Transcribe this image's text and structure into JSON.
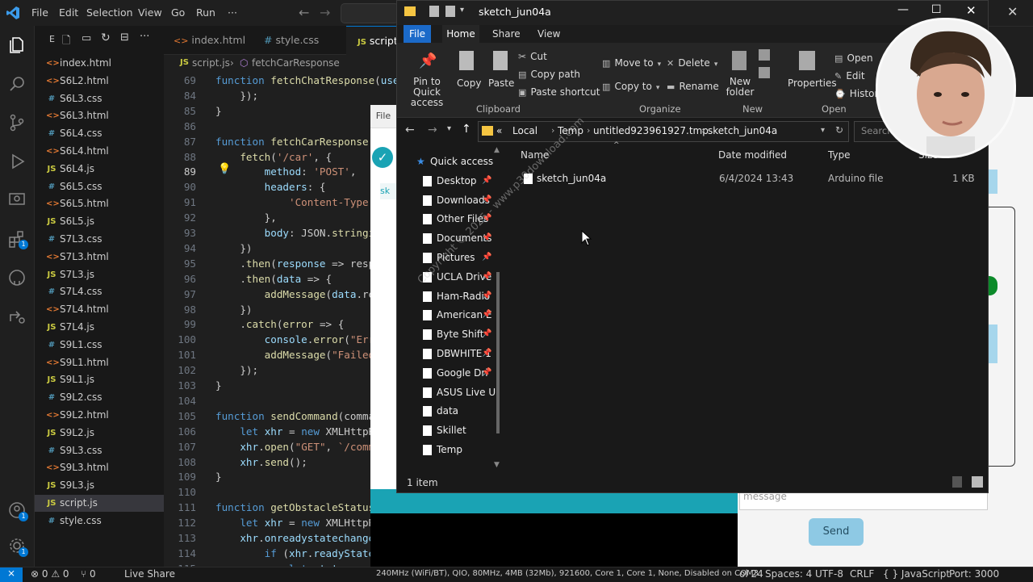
{
  "vscode": {
    "menu": [
      "File",
      "Edit",
      "Selection",
      "View",
      "Go",
      "Run",
      "···"
    ],
    "explorer_header": "E",
    "files": [
      {
        "name": "index.html",
        "type": "html"
      },
      {
        "name": "S6L2.html",
        "type": "html"
      },
      {
        "name": "S6L3.css",
        "type": "css"
      },
      {
        "name": "S6L3.html",
        "type": "html"
      },
      {
        "name": "S6L4.css",
        "type": "css"
      },
      {
        "name": "S6L4.html",
        "type": "html"
      },
      {
        "name": "S6L4.js",
        "type": "js"
      },
      {
        "name": "S6L5.css",
        "type": "css"
      },
      {
        "name": "S6L5.html",
        "type": "html"
      },
      {
        "name": "S6L5.js",
        "type": "js"
      },
      {
        "name": "S7L3.css",
        "type": "css"
      },
      {
        "name": "S7L3.html",
        "type": "html"
      },
      {
        "name": "S7L3.js",
        "type": "js"
      },
      {
        "name": "S7L4.css",
        "type": "css"
      },
      {
        "name": "S7L4.html",
        "type": "html"
      },
      {
        "name": "S7L4.js",
        "type": "js"
      },
      {
        "name": "S9L1.css",
        "type": "css"
      },
      {
        "name": "S9L1.html",
        "type": "html"
      },
      {
        "name": "S9L1.js",
        "type": "js"
      },
      {
        "name": "S9L2.css",
        "type": "css"
      },
      {
        "name": "S9L2.html",
        "type": "html"
      },
      {
        "name": "S9L2.js",
        "type": "js"
      },
      {
        "name": "S9L3.css",
        "type": "css"
      },
      {
        "name": "S9L3.html",
        "type": "html"
      },
      {
        "name": "S9L3.js",
        "type": "js"
      },
      {
        "name": "script.js",
        "type": "js",
        "selected": true
      },
      {
        "name": "style.css",
        "type": "css"
      }
    ],
    "tabs": [
      "index.html",
      "style.css",
      "script"
    ],
    "breadcrumb": {
      "file": "script.js",
      "symbol": "fetchCarResponse"
    },
    "code_lines": [
      {
        "n": "69",
        "t": "function fetchChatResponse(user"
      },
      {
        "n": "84",
        "t": "    });"
      },
      {
        "n": "85",
        "t": "}"
      },
      {
        "n": "86",
        "t": ""
      },
      {
        "n": "87",
        "t": "function fetchCarResponse(u"
      },
      {
        "n": "88",
        "t": "    fetch('/car', {"
      },
      {
        "n": "89",
        "t": "        method: 'POST',"
      },
      {
        "n": "90",
        "t": "        headers: {"
      },
      {
        "n": "91",
        "t": "            'Content-Type'"
      },
      {
        "n": "92",
        "t": "        },"
      },
      {
        "n": "93",
        "t": "        body: JSON.stringi"
      },
      {
        "n": "94",
        "t": "    })"
      },
      {
        "n": "95",
        "t": "    .then(response => respo"
      },
      {
        "n": "96",
        "t": "    .then(data => {"
      },
      {
        "n": "97",
        "t": "        addMessage(data.res"
      },
      {
        "n": "98",
        "t": "    })"
      },
      {
        "n": "99",
        "t": "    .catch(error => {"
      },
      {
        "n": "100",
        "t": "        console.error(\"Erro"
      },
      {
        "n": "101",
        "t": "        addMessage(\"Failed"
      },
      {
        "n": "102",
        "t": "    });"
      },
      {
        "n": "103",
        "t": "}"
      },
      {
        "n": "104",
        "t": ""
      },
      {
        "n": "105",
        "t": "function sendCommand(comma"
      },
      {
        "n": "106",
        "t": "    let xhr = new XMLHttpRe"
      },
      {
        "n": "107",
        "t": "    xhr.open(\"GET\", `/comma"
      },
      {
        "n": "108",
        "t": "    xhr.send();"
      },
      {
        "n": "109",
        "t": "}"
      },
      {
        "n": "110",
        "t": ""
      },
      {
        "n": "111",
        "t": "function getObstacleStatus("
      },
      {
        "n": "112",
        "t": "    let xhr = new XMLHttpRe"
      },
      {
        "n": "113",
        "t": "    xhr.onreadystatechange"
      },
      {
        "n": "114",
        "t": "        if (xhr.readyState"
      },
      {
        "n": "115",
        "t": "            let status = xh"
      }
    ],
    "status": {
      "problems": "⊗ 0 ⚠ 0",
      "ports": "⑂ 0",
      "live_share": "Live Share",
      "arduino_board": "240MHz (WiFi/BT), QIO, 80MHz, 4MB (32Mb), 921600, Core 1, Core 1, None, Disabled on COM3",
      "ln": "ol 24",
      "spaces": "Spaces: 4",
      "encoding": "UTF-8",
      "eol": "CRLF",
      "language": "{ } JavaScript",
      "port": "Port: 3000"
    }
  },
  "explorer_window": {
    "title": "sketch_jun04a",
    "menu": [
      "File",
      "Home",
      "Share",
      "View"
    ],
    "ribbon": {
      "clipboard": {
        "pin": "Pin to Quick access",
        "copy": "Copy",
        "paste": "Paste",
        "cut": "Cut",
        "copy_path": "Copy path",
        "paste_shortcut": "Paste shortcut",
        "group": "Clipboard"
      },
      "organize": {
        "move_to": "Move to",
        "copy_to": "Copy to",
        "delete": "Delete",
        "rename": "Rename",
        "group": "Organize"
      },
      "new": {
        "new_folder": "New folder",
        "group": "New"
      },
      "open": {
        "properties": "Properties",
        "open": "Open",
        "edit": "Edit",
        "history": "History",
        "group": "Open"
      }
    },
    "address": [
      "«",
      "Local",
      "Temp",
      "untitled923961927.tmp",
      "sketch_jun04a"
    ],
    "search_placeholder": "Search s",
    "nav": [
      {
        "label": "Quick access",
        "pin": false,
        "root": true
      },
      {
        "label": "Desktop",
        "pin": true
      },
      {
        "label": "Downloads",
        "pin": true
      },
      {
        "label": "Other Files",
        "pin": true
      },
      {
        "label": "Documents",
        "pin": true
      },
      {
        "label": "Pictures",
        "pin": true
      },
      {
        "label": "UCLA Drive",
        "pin": true
      },
      {
        "label": "Ham-Radio",
        "pin": true
      },
      {
        "label": "American E",
        "pin": true
      },
      {
        "label": "Byte Shift",
        "pin": true
      },
      {
        "label": "DBWHITE 1",
        "pin": true
      },
      {
        "label": "Google Dri",
        "pin": true
      },
      {
        "label": "ASUS Live Upd",
        "pin": false
      },
      {
        "label": "data",
        "pin": false
      },
      {
        "label": "Skillet",
        "pin": false
      },
      {
        "label": "Temp",
        "pin": false
      }
    ],
    "columns": [
      "Name",
      "Date modified",
      "Type",
      "Size"
    ],
    "files": [
      {
        "name": "sketch_jun04a",
        "date": "6/4/2024 13:43",
        "type": "Arduino file",
        "size": "1 KB"
      }
    ],
    "status": "1 item"
  },
  "arduino": {
    "menu_file": "File",
    "tab": "sk"
  },
  "webapp": {
    "message_placeholder": "message",
    "send": "Send"
  },
  "watermark": "Copyright © 2025 - www.p30download.com",
  "colors": {
    "accent": "#0078d4",
    "teal": "#1aa3b4",
    "send_button": "#8ec9e4"
  }
}
